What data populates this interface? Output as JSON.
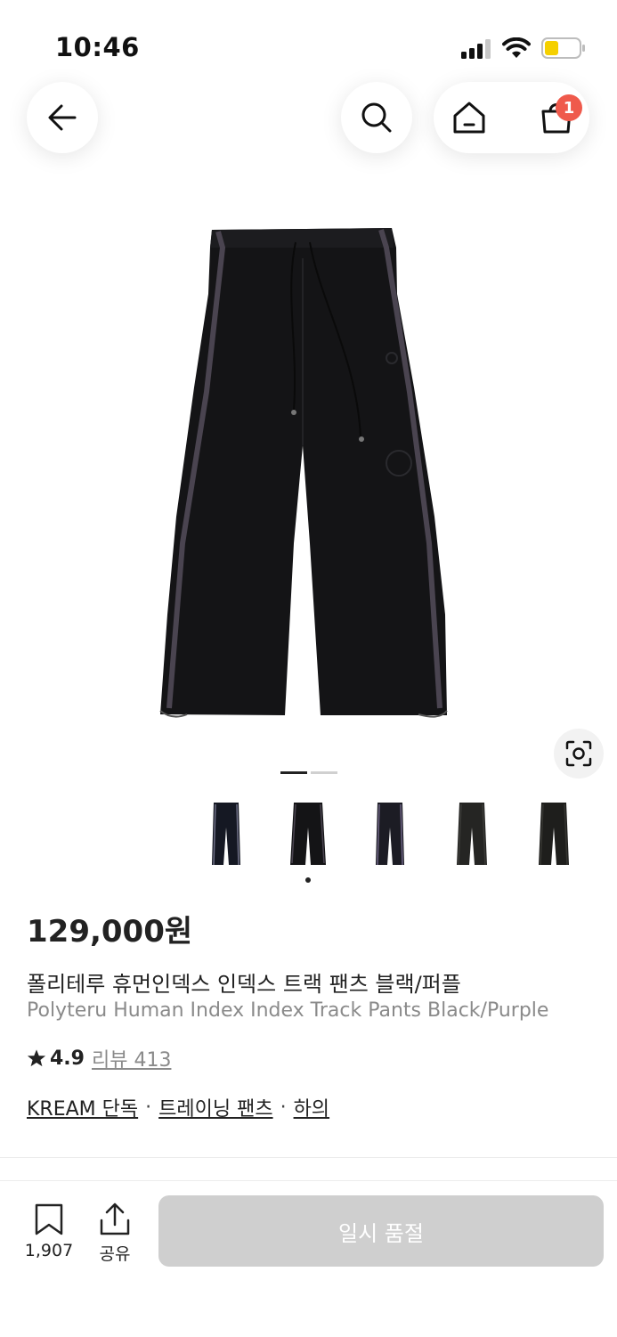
{
  "status_bar": {
    "time": "10:46"
  },
  "header": {
    "cart_count": "1"
  },
  "gallery": {
    "indicator_active": 0,
    "indicator_total": 2
  },
  "thumbnails": [
    "thumb-1",
    "thumb-2",
    "thumb-3",
    "thumb-4",
    "thumb-5"
  ],
  "product": {
    "price": "129,000원",
    "name_ko": "폴리테루 휴먼인덱스 인덱스 트랙 팬츠 블랙/퍼플",
    "name_en": "Polyteru Human Index Index Track Pants Black/Purple",
    "rating": "4.9",
    "review_label": "리뷰 413",
    "tags": [
      "KREAM 단독",
      "트레이닝 팬츠",
      "하의"
    ]
  },
  "bottom_bar": {
    "bookmark_count": "1,907",
    "share_label": "공유",
    "cta_label": "일시 품절"
  },
  "colors": {
    "badge": "#ef5a4c",
    "cta_disabled": "#cfcfcf",
    "stripe": "#4a4450"
  }
}
